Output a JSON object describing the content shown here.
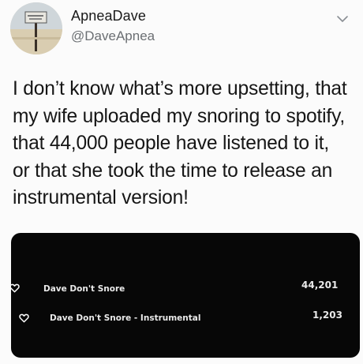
{
  "profile": {
    "display_name": "ApneaDave",
    "handle": "@DaveApnea",
    "avatar_icon": "beach-sign-avatar-icon",
    "menu_icon": "chevron-down-icon"
  },
  "tweet": {
    "lines": [
      "I don’t know what’s more upsetting, that",
      "my wife uploaded my snoring to spotify,",
      "that 44,000 people have listened to it,",
      "or that she took the time to release an",
      "instrumental version!"
    ]
  },
  "media": {
    "tracks": [
      {
        "title": "Dave Don't Snore",
        "plays": "44,201",
        "icon": "heart-outline-icon"
      },
      {
        "title": "Dave Don't Snore - Instrumental",
        "plays": "1,203",
        "icon": "heart-outline-icon"
      }
    ]
  },
  "colors": {
    "background": "#fbfbfb",
    "text": "#161616",
    "handle": "#6b6f73",
    "media_background": "#070707",
    "media_text": "#e9e9e9"
  }
}
